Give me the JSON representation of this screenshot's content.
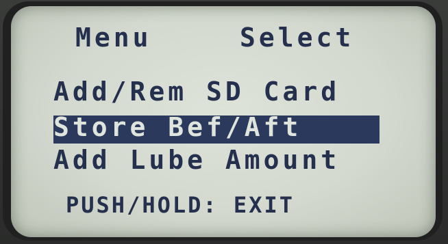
{
  "screen": {
    "header": {
      "left_label": "Menu",
      "right_label": "Select"
    },
    "menu": {
      "items": [
        {
          "label": "Add/Rem SD Card",
          "selected": false
        },
        {
          "label": "Store Bef/Aft",
          "selected": true
        },
        {
          "label": "Add Lube Amount",
          "selected": false
        }
      ]
    },
    "footer": {
      "hint": "PUSH/HOLD: EXIT"
    }
  },
  "colors": {
    "lcd_background": "#d6dcd2",
    "lcd_text": "#25304e",
    "highlight": "#2b3a5c"
  }
}
